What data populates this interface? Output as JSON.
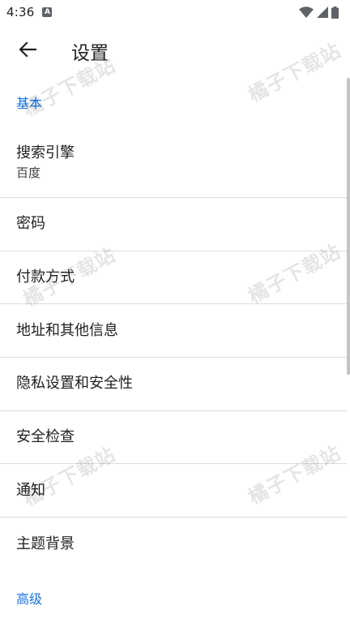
{
  "status_bar": {
    "time": "4:36",
    "app_icon_letter": "A",
    "icons": [
      "wifi-icon",
      "cell-signal-icon",
      "battery-icon"
    ]
  },
  "app_bar": {
    "back_icon": "arrow-left-icon",
    "title": "设置"
  },
  "sections": {
    "basic_header": "基本",
    "advanced_header": "高级"
  },
  "items": [
    {
      "title": "搜索引擎",
      "subtitle": "百度"
    },
    {
      "title": "密码"
    },
    {
      "title": "付款方式"
    },
    {
      "title": "地址和其他信息"
    },
    {
      "title": "隐私设置和安全性"
    },
    {
      "title": "安全检查"
    },
    {
      "title": "通知"
    },
    {
      "title": "主题背景"
    }
  ],
  "watermark": {
    "text": "橘子下载站"
  },
  "colors": {
    "accent": "#1a73e8",
    "divider": "#dadce0",
    "text_primary": "#202124"
  }
}
